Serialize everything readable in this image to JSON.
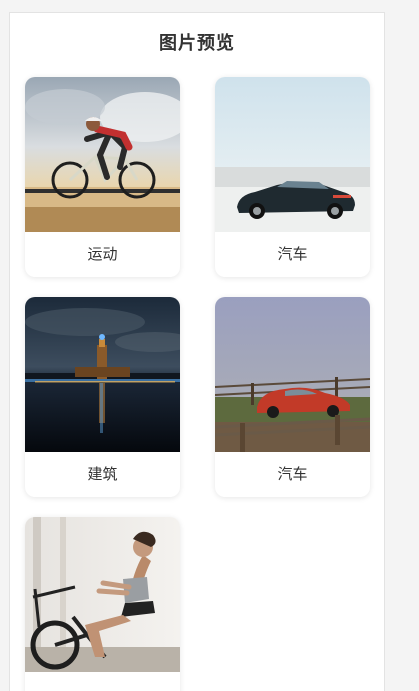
{
  "page": {
    "title": "图片预览"
  },
  "gallery": {
    "items": [
      {
        "caption": "运动",
        "icon": "cyclist-photo"
      },
      {
        "caption": "汽车",
        "icon": "black-car-photo"
      },
      {
        "caption": "建筑",
        "icon": "night-tower-photo"
      },
      {
        "caption": "汽车",
        "icon": "red-beetle-photo"
      },
      {
        "caption": "",
        "icon": "fitness-bike-photo"
      }
    ]
  }
}
